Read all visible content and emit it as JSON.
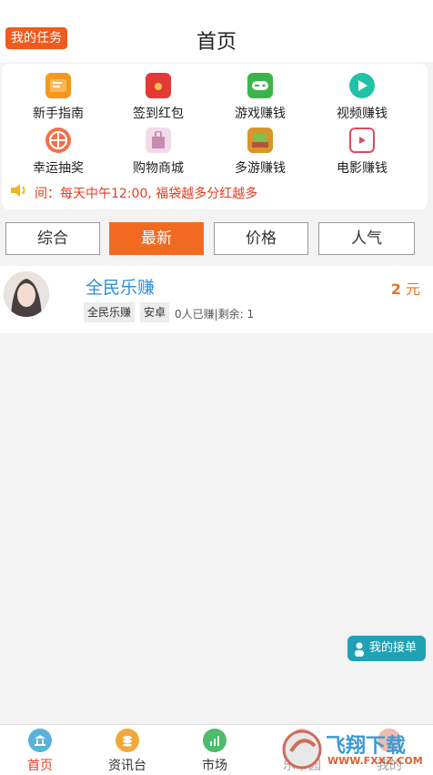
{
  "header": {
    "task_button": "我的任务",
    "title": "首页"
  },
  "grid": [
    {
      "label": "新手指南",
      "icon": "guide-book-icon",
      "color": "#f39a1c"
    },
    {
      "label": "签到红包",
      "icon": "red-envelope-icon",
      "color": "#e53935"
    },
    {
      "label": "游戏赚钱",
      "icon": "gamepad-icon",
      "color": "#3bb54a"
    },
    {
      "label": "视频赚钱",
      "icon": "play-icon",
      "color": "#20c2a8"
    },
    {
      "label": "幸运抽奖",
      "icon": "lottery-wheel-icon",
      "color": "#f2704a"
    },
    {
      "label": "购物商城",
      "icon": "shopping-bag-icon",
      "color": "#c98ab0"
    },
    {
      "label": "多游赚钱",
      "icon": "arcade-icon",
      "color": "#d9952a"
    },
    {
      "label": "电影赚钱",
      "icon": "film-icon",
      "color": "#e24a5c"
    }
  ],
  "notice": {
    "icon": "speaker-icon",
    "text": "间：每天中午12:00, 福袋越多分红越多"
  },
  "tabs": [
    "综合",
    "最新",
    "价格",
    "人气"
  ],
  "active_tab": "最新",
  "task": {
    "title": "全民乐赚",
    "price_value": "2",
    "price_unit": "元",
    "tags": [
      "全民乐赚",
      "安卓"
    ],
    "meta": "0人已赚|剩余: 1"
  },
  "float_button": {
    "label": "我的接单",
    "icon": "person-icon"
  },
  "bottom_nav": [
    {
      "label": "首页",
      "icon": "bank-icon",
      "color": "#5ab2d8",
      "active": true
    },
    {
      "label": "资讯台",
      "icon": "coins-icon",
      "color": "#f3a93a",
      "active": false
    },
    {
      "label": "市场",
      "icon": "chart-icon",
      "color": "#4cbb6a",
      "active": false
    },
    {
      "label": "乐币园",
      "icon": "garden-icon",
      "color": "#e06b4a",
      "active": false
    },
    {
      "label": "我的",
      "icon": "user-icon",
      "color": "#e06b4a",
      "active": false
    }
  ],
  "watermark": {
    "text": "飞翔下载",
    "url": "WWW.FXXZ.COM"
  }
}
